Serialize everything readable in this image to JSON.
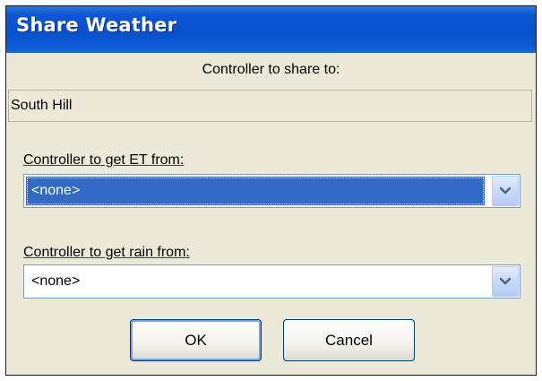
{
  "dialog": {
    "title": "Share Weather",
    "share_caption": "Controller to share to:",
    "share_target": "South Hill"
  },
  "et_field": {
    "label": "Controller to get ET from:",
    "value": "<none>",
    "arrow_icon": "chevron-down-icon"
  },
  "rain_field": {
    "label": "Controller to get rain from:",
    "value": "<none>",
    "arrow_icon": "chevron-down-icon"
  },
  "buttons": {
    "ok_label": "OK",
    "cancel_label": "Cancel"
  },
  "colors": {
    "titlebar": "#0750cc",
    "selection": "#316ac5",
    "dialog_bg": "#ece9d8"
  }
}
